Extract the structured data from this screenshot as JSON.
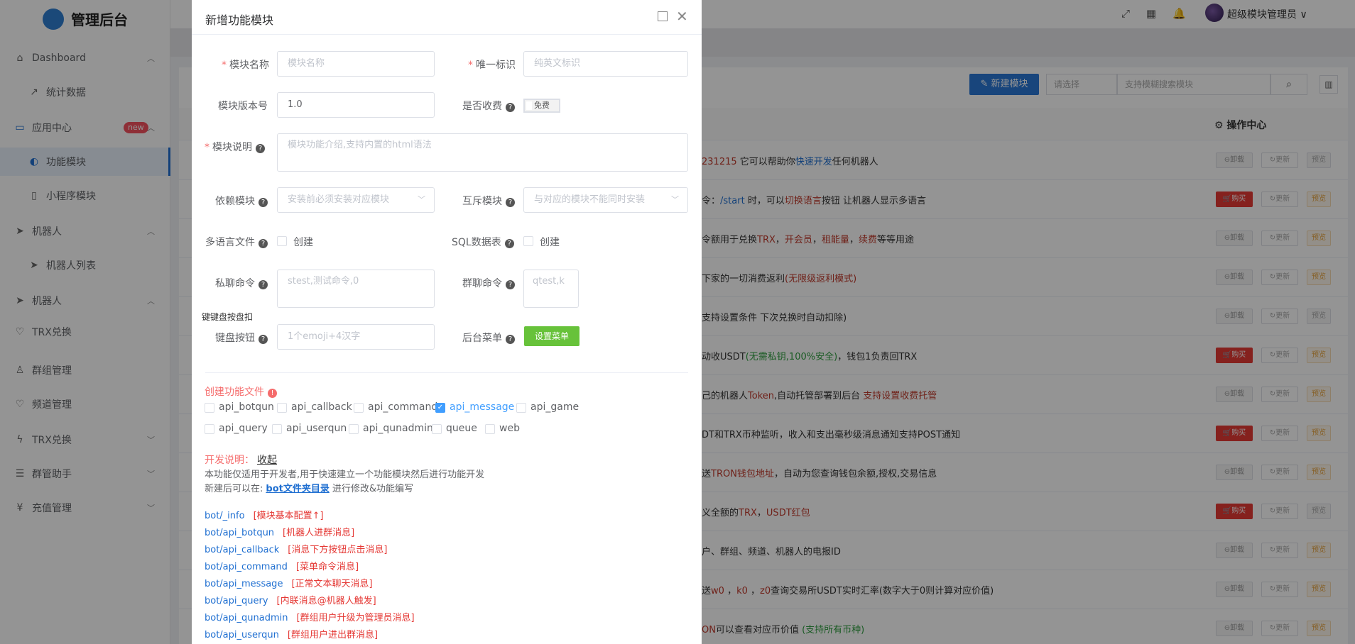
{
  "app": {
    "title": "管理后台"
  },
  "sidebar": {
    "items": [
      {
        "label": "Dashboard",
        "icon": "home-icon",
        "arrow": "^"
      },
      {
        "label": "统计数据",
        "icon": "trend-icon"
      },
      {
        "label": "应用中心",
        "icon": "app-icon",
        "badge": "new",
        "arrow": "^"
      },
      {
        "label": "功能模块",
        "icon": "toggle-icon"
      },
      {
        "label": "小程序模块",
        "icon": "mobile-icon"
      },
      {
        "label": "机器人",
        "icon": "send-icon",
        "arrow": "^"
      },
      {
        "label": "机器人列表",
        "icon": "send-icon"
      },
      {
        "label": "机器人",
        "icon": "send-icon",
        "arrow": "^"
      },
      {
        "label": "TRX兑换",
        "icon": "heart-icon"
      },
      {
        "label": "群组管理",
        "icon": "user-icon"
      },
      {
        "label": "频道管理",
        "icon": "heart-icon"
      },
      {
        "label": "TRX兑换",
        "icon": "bolt-icon",
        "arrow": "v"
      },
      {
        "label": "群管助手",
        "icon": "list-icon",
        "arrow": "v"
      },
      {
        "label": "充值管理",
        "icon": "yen-icon",
        "arrow": "v"
      }
    ]
  },
  "header": {
    "user_name": "超级模块管理员 ∨",
    "fullscreen_icon": "⤢",
    "translate_icon": "▦",
    "bell_icon": "🔔"
  },
  "toolbar": {
    "new_button": "✎ 新建模块",
    "select_placeholder": "请选择",
    "search_placeholder": "支持模糊搜索模块",
    "search_icon": "⌕",
    "columns_icon": "▥"
  },
  "table": {
    "op_header": "⚙ 操作中心",
    "update_label": "↻更新",
    "preview_label": "预览",
    "rows": [
      {
        "parts": [
          [
            "b",
            "231215"
          ],
          [
            "t",
            " 它可以帮助你"
          ],
          [
            "i",
            "快速开发"
          ],
          [
            "t",
            "任何机器人"
          ]
        ],
        "action": "⊖卸载",
        "type": "del",
        "preview": "gray"
      },
      {
        "parts": [
          [
            "t",
            "令："
          ],
          [
            "i",
            "/start"
          ],
          [
            "t",
            " 时，可以"
          ],
          [
            "b",
            "切换语言"
          ],
          [
            "t",
            "按钮 让机器人显示多语言"
          ]
        ],
        "action": "🛒购买",
        "type": "buy",
        "preview": "yellow"
      },
      {
        "parts": [
          [
            "t",
            "令额用于兑换"
          ],
          [
            "b",
            "TRX"
          ],
          [
            "t",
            "，"
          ],
          [
            "b",
            "开会员"
          ],
          [
            "t",
            "，"
          ],
          [
            "b",
            "租能量"
          ],
          [
            "t",
            "，"
          ],
          [
            "b",
            "续费"
          ],
          [
            "t",
            "等等用途"
          ]
        ],
        "action": "⊖卸载",
        "type": "del",
        "preview": "yellow"
      },
      {
        "parts": [
          [
            "t",
            "下家的一切消费返利"
          ],
          [
            "b",
            "(无限级返利模式)"
          ]
        ],
        "action": "⊖卸载",
        "type": "del",
        "preview": "yellow"
      },
      {
        "parts": [
          [
            "t",
            "支持设置条件 下次兑换时自动扣除)"
          ]
        ],
        "action": "⊖卸载",
        "type": "del",
        "preview": "gray"
      },
      {
        "parts": [
          [
            "t",
            "动收USDT"
          ],
          [
            "g",
            "(无需私钥,100%安全)"
          ],
          [
            "t",
            "，钱包1负责回TRX"
          ]
        ],
        "action": "🛒购买",
        "type": "buy",
        "preview": "yellow"
      },
      {
        "parts": [
          [
            "t",
            "己的机器人"
          ],
          [
            "b",
            "Token"
          ],
          [
            "t",
            ",自动托管部署到后台 "
          ],
          [
            "b",
            "支持设置收费托管"
          ]
        ],
        "action": "⊖卸载",
        "type": "del",
        "preview": "yellow"
      },
      {
        "parts": [
          [
            "t",
            "DT和TRX币种监听，收入和支出毫秒级消息通知支持POST通知"
          ]
        ],
        "action": "🛒购买",
        "type": "buy",
        "preview": "yellow"
      },
      {
        "parts": [
          [
            "t",
            "送"
          ],
          [
            "b",
            "TRON钱包地址"
          ],
          [
            "t",
            "，自动为您查询钱包余额,授权,交易信息"
          ]
        ],
        "action": "⊖卸载",
        "type": "del",
        "preview": "yellow"
      },
      {
        "parts": [
          [
            "t",
            "义全额的"
          ],
          [
            "b",
            "TRX"
          ],
          [
            "t",
            "，"
          ],
          [
            "b",
            "USDT红包"
          ]
        ],
        "action": "🛒购买",
        "type": "buy",
        "preview": "gray"
      },
      {
        "parts": [
          [
            "t",
            "户、群组、频道、机器人的电报ID"
          ]
        ],
        "action": "⊖卸载",
        "type": "del",
        "preview": "yellow"
      },
      {
        "parts": [
          [
            "t",
            "送"
          ],
          [
            "b",
            "w0"
          ],
          [
            "t",
            " ，"
          ],
          [
            "b",
            "k0"
          ],
          [
            "t",
            " ，"
          ],
          [
            "b",
            "z0"
          ],
          [
            "t",
            "查询交易所USDT实时汇率(数字大于0则计算对应价值)"
          ]
        ],
        "action": "⊖卸载",
        "type": "del",
        "preview": "yellow"
      },
      {
        "parts": [
          [
            "b",
            "ON"
          ],
          [
            "t",
            "可以查看对应币价值 "
          ],
          [
            "g",
            "(支持所有币种)"
          ]
        ],
        "action": "⊖卸载",
        "type": "del",
        "preview": "yellow"
      }
    ]
  },
  "dialog": {
    "title": "新增功能模块",
    "close_icon": "✕",
    "fields": {
      "module_name_label": "模块名称",
      "module_name_placeholder": "模块名称",
      "unique_id_label": "唯一标识",
      "unique_id_placeholder": "纯英文标识",
      "version_label": "模块版本号",
      "version_value": "1.0",
      "charge_label": "是否收费",
      "charge_switch": "免费",
      "desc_label": "模块说明",
      "desc_placeholder": "模块功能介绍,支持内置的html语法",
      "depend_label": "依赖模块",
      "depend_placeholder": "安装前必须安装对应模块",
      "conflict_label": "互斥模块",
      "conflict_placeholder": "与对应的模块不能同时安装",
      "lang_label": "多语言文件",
      "lang_checkbox": "创建",
      "sql_label": "SQL数据表",
      "sql_checkbox": "创建",
      "private_cmd_label": "私聊命令",
      "private_cmd_placeholder": "stest,测试命令,0",
      "group_cmd_label": "群聊命令",
      "group_cmd_placeholder": "qtest,k",
      "keyboard_tip": "键键盘按盘扣",
      "keyboard_label": "键盘按钮",
      "keyboard_placeholder": "1个emoji+4汉字",
      "admin_menu_label": "后台菜单",
      "admin_menu_button": "设置菜单"
    },
    "create_files": {
      "title": "创建功能文件",
      "row1": [
        {
          "label": "api_botqun",
          "checked": false
        },
        {
          "label": "api_callback",
          "checked": false
        },
        {
          "label": "api_command",
          "checked": false
        },
        {
          "label": "api_message",
          "checked": true
        },
        {
          "label": "api_game",
          "checked": false
        }
      ],
      "row2": [
        {
          "label": "api_query",
          "checked": false
        },
        {
          "label": "api_userqun",
          "checked": false
        },
        {
          "label": "api_qunadmin",
          "checked": false
        },
        {
          "label": "queue",
          "checked": false
        },
        {
          "label": "web",
          "checked": false
        }
      ]
    },
    "dev": {
      "title": "开发说明：",
      "collapse": "收起",
      "line1": "本功能仅适用于开发者,用于快速建立一个功能模块然后进行功能开发",
      "line2_prefix": "新建后可以在:",
      "line2_link": "bot文件夹目录",
      "line2_suffix": "进行修改&功能编写",
      "paths": [
        {
          "path": "bot/_info",
          "desc": "[模块基本配置↑]"
        },
        {
          "path": "bot/api_botqun",
          "desc": "[机器人进群消息]"
        },
        {
          "path": "bot/api_callback",
          "desc": "[消息下方按钮点击消息]"
        },
        {
          "path": "bot/api_command",
          "desc": "[菜单命令消息]"
        },
        {
          "path": "bot/api_message",
          "desc": "[正常文本聊天消息]"
        },
        {
          "path": "bot/api_query",
          "desc": "[内联消息@机器人触发]"
        },
        {
          "path": "bot/api_qunadmin",
          "desc": "[群组用户升级为管理员消息]"
        },
        {
          "path": "bot/api_userqun",
          "desc": "[群组用户进出群消息]"
        }
      ]
    }
  }
}
